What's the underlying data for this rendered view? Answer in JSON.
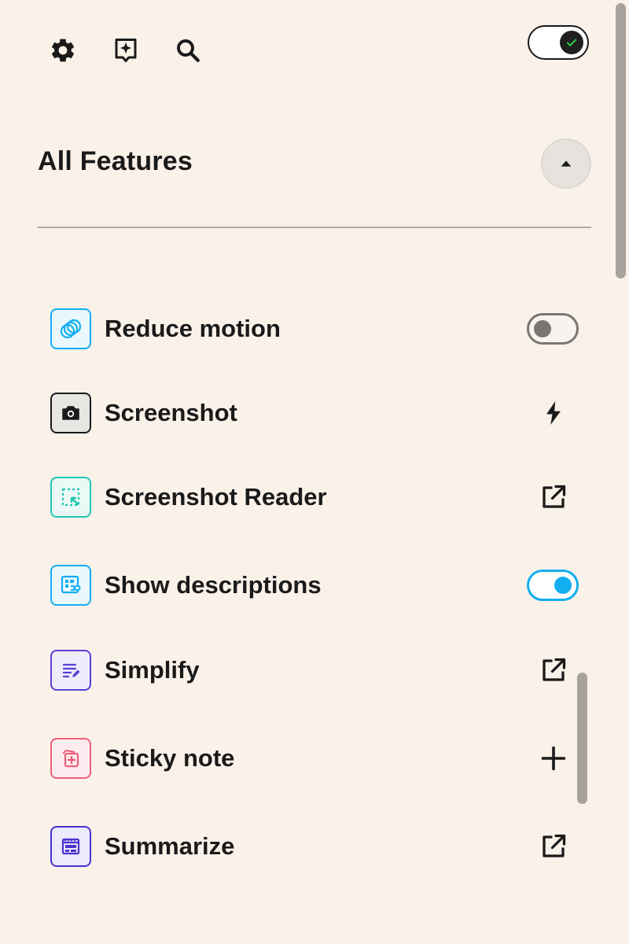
{
  "toolbar": {
    "settings_icon": "gear-icon",
    "ai_icon": "sparkle-chat-icon",
    "search_icon": "search-icon",
    "master_toggle_state": "on"
  },
  "section": {
    "title": "All Features",
    "collapse_icon": "triangle-up-icon"
  },
  "features": [
    {
      "label": "Reduce motion",
      "icon": "reduce-motion-icon",
      "color": "#12aef0",
      "action": "toggle",
      "state": "off"
    },
    {
      "label": "Screenshot",
      "icon": "camera-icon",
      "color": "#1a1a1a",
      "action": "lightning",
      "state": ""
    },
    {
      "label": "Screenshot Reader",
      "icon": "screenshot-reader-icon",
      "color": "#1fc7b3",
      "action": "open-external",
      "state": ""
    },
    {
      "label": "Show descriptions",
      "icon": "show-descriptions-icon",
      "color": "#12aef0",
      "action": "toggle",
      "state": "on"
    },
    {
      "label": "Simplify",
      "icon": "simplify-icon",
      "color": "#5b3fd6",
      "action": "open-external",
      "state": ""
    },
    {
      "label": "Sticky note",
      "icon": "sticky-note-icon",
      "color": "#ee5f78",
      "action": "add",
      "state": ""
    },
    {
      "label": "Summarize",
      "icon": "summarize-icon",
      "color": "#4a32d0",
      "action": "open-external",
      "state": ""
    }
  ],
  "colors": {
    "background": "#faf1e9",
    "text": "#1a1a1a",
    "accent": "#12aef0",
    "toggle_off": "#7a7673",
    "check_green": "#2ecc40"
  }
}
